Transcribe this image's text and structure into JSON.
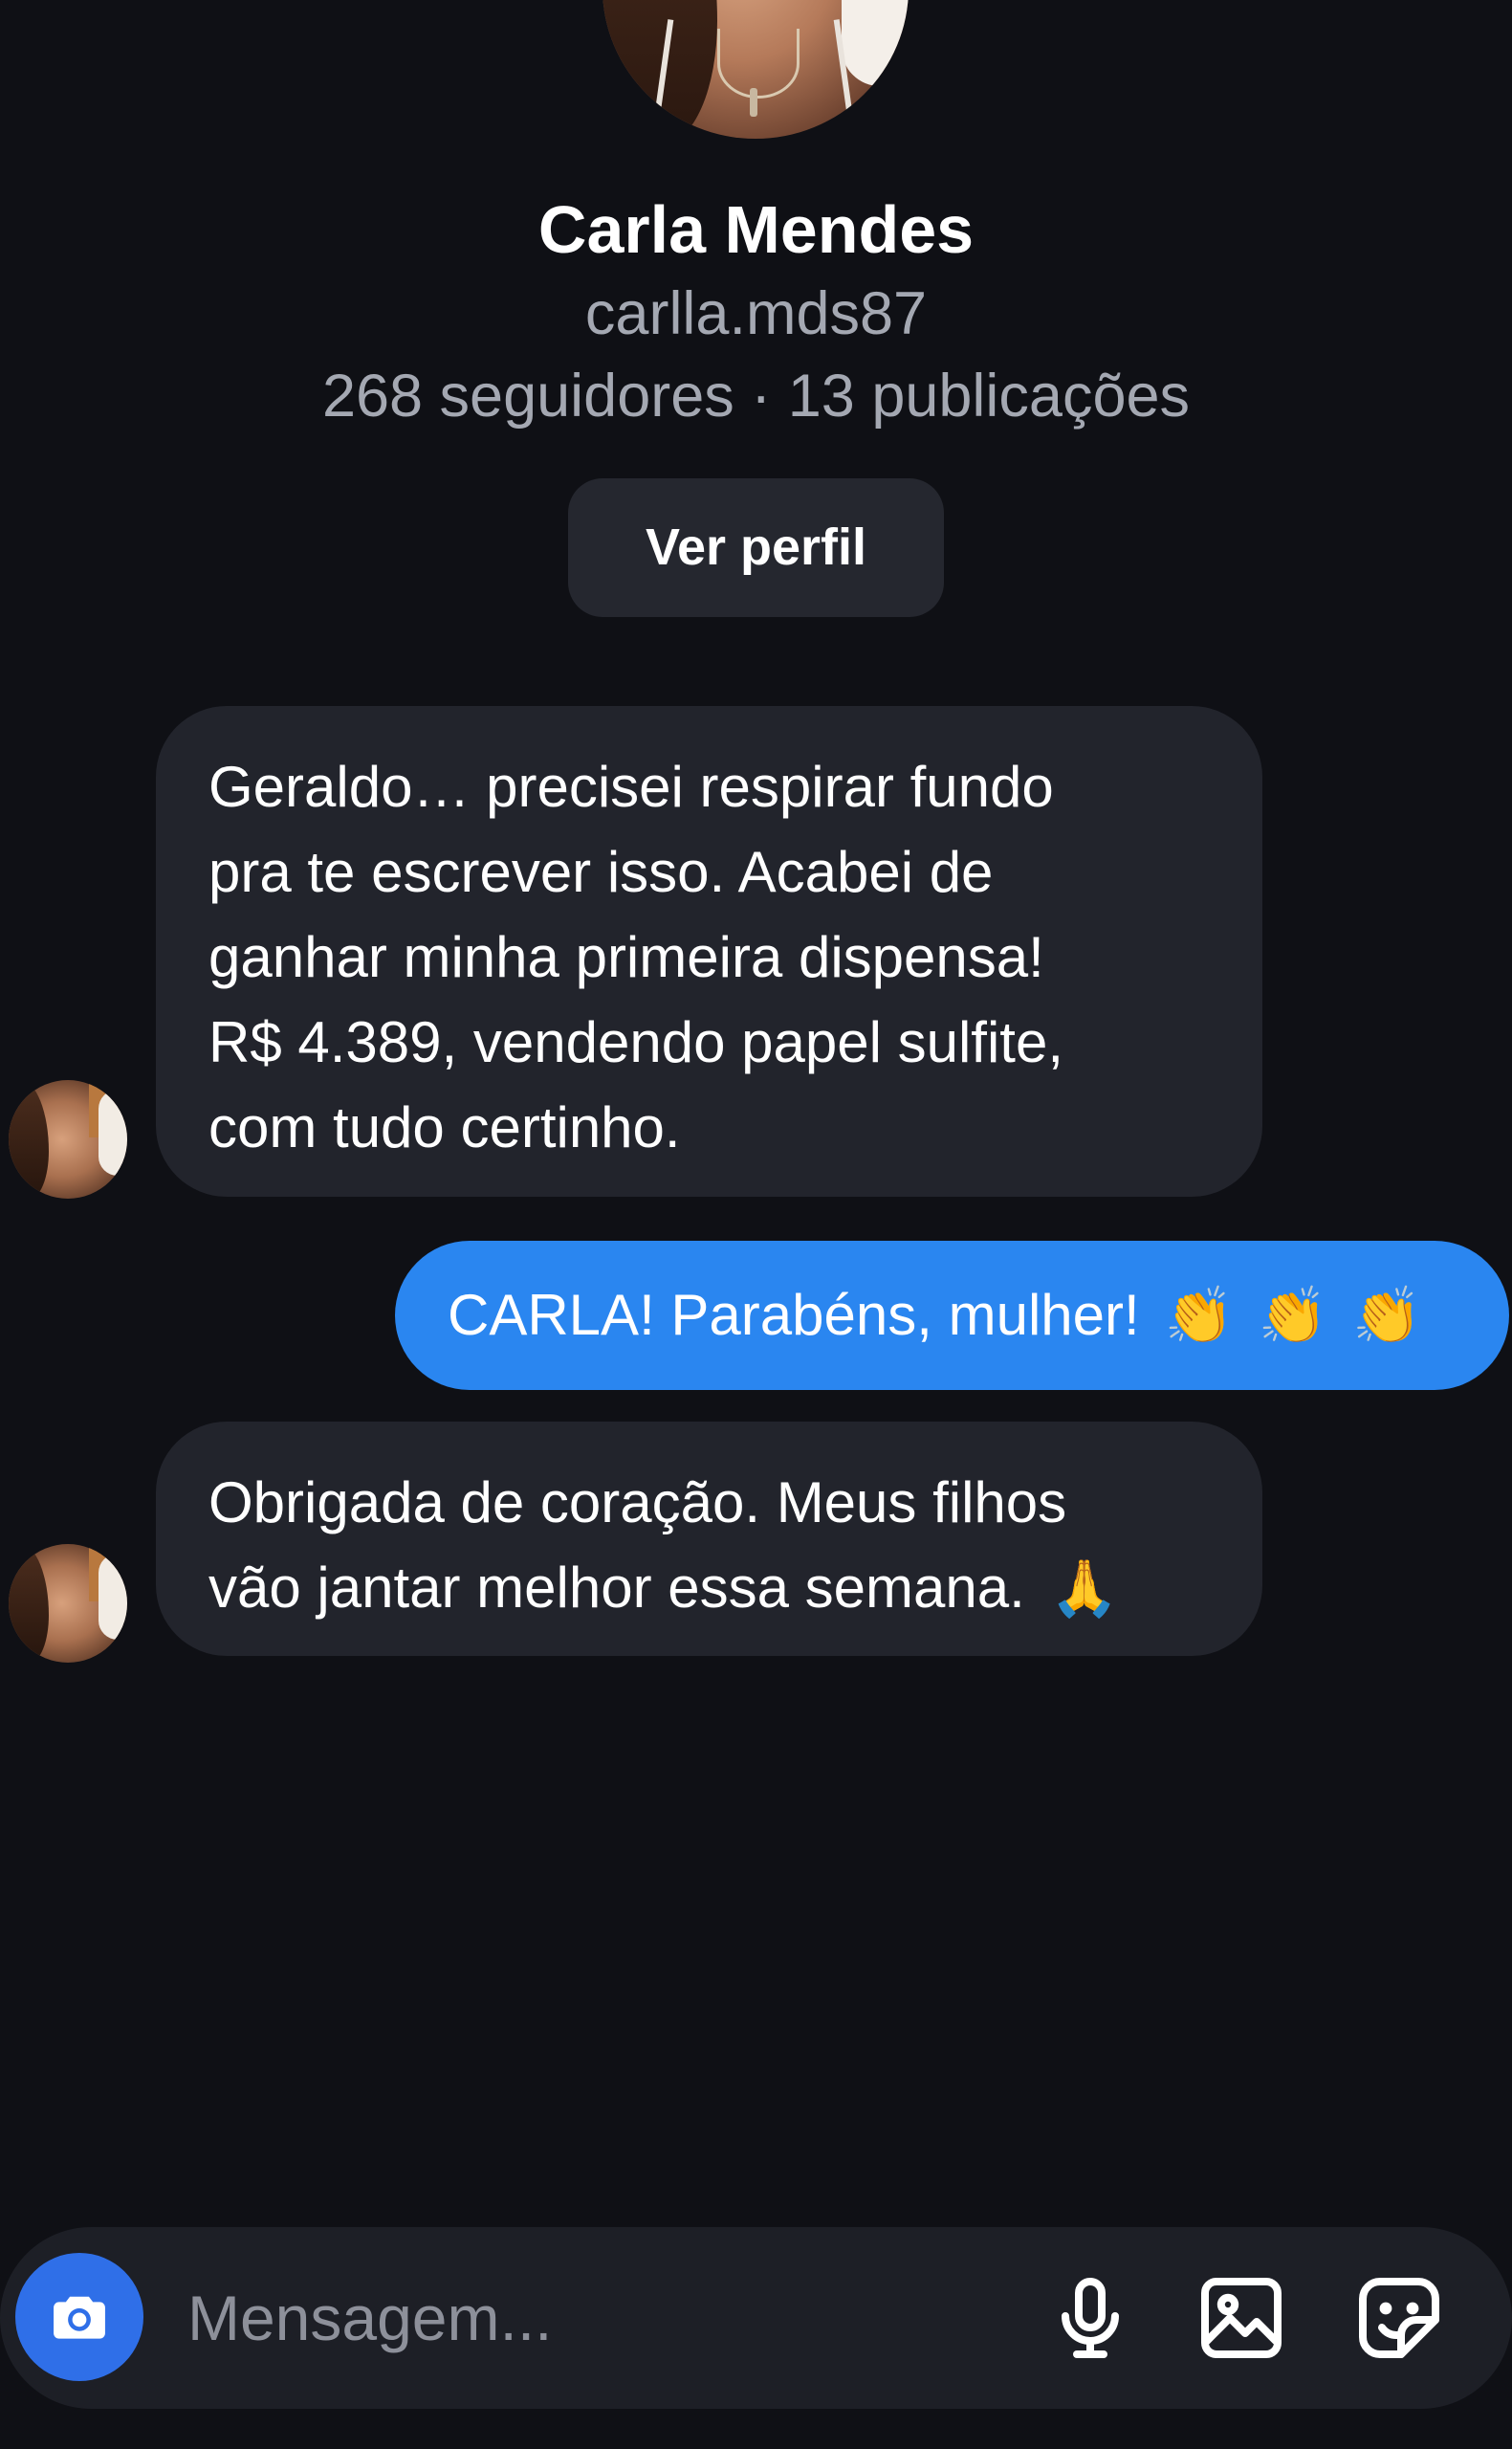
{
  "profile": {
    "name": "Carla Mendes",
    "username": "carlla.mds87",
    "stats": "268 seguidores · 13 publicações",
    "view_profile_label": "Ver perfil"
  },
  "messages": [
    {
      "direction": "incoming",
      "lines": [
        "Geraldo… precisei respirar fundo",
        "pra te escrever isso. Acabei de",
        "ganhar minha primeira dispensa!",
        "R$ 4.389, vendendo papel sulfite,",
        "com tudo certinho."
      ]
    },
    {
      "direction": "outgoing",
      "text": "CARLA! Parabéns, mulher!",
      "emoji": [
        "clapping-hands",
        "clapping-hands",
        "clapping-hands"
      ]
    },
    {
      "direction": "incoming",
      "lines": [
        "Obrigada de coração. Meus filhos",
        "vão jantar melhor essa semana."
      ],
      "emoji": [
        "folded-hands"
      ]
    }
  ],
  "composer": {
    "placeholder": "Mensagem...",
    "icons": [
      "camera-icon",
      "microphone-icon",
      "gallery-icon",
      "sticker-icon"
    ]
  },
  "colors": {
    "background": "#0f1015",
    "incoming_bubble": "#22242c",
    "outgoing_bubble": "#2a86f0",
    "camera_button": "#2f6fe8",
    "secondary_text": "#a4a8b2"
  }
}
